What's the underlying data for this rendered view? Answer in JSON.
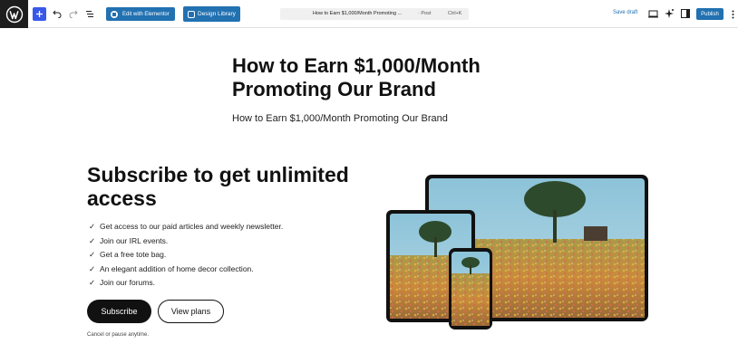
{
  "toolbar": {
    "elementor_label": "Edit with Elementor",
    "design_library_label": "Design Library",
    "command_bar": {
      "title": "How to Earn $1,000/Month Promoting ...",
      "type": "· Post",
      "shortcut": "Ctrl+K"
    },
    "save_draft_label": "Save draft",
    "publish_label": "Publish"
  },
  "post": {
    "title": "How to Earn $1,000/Month Promoting Our Brand",
    "subtitle": "How to Earn $1,000/Month Promoting Our Brand"
  },
  "subscribe": {
    "heading": "Subscribe to get unlimited access",
    "check_glyph": "✓",
    "benefits": [
      "Get access to our paid articles and weekly newsletter.",
      "Join our IRL events.",
      "Get a free tote bag.",
      "An elegant addition of home decor collection.",
      "Join our forums."
    ],
    "subscribe_label": "Subscribe",
    "plans_label": "View plans",
    "cancel_note": "Cancel or pause anytime."
  },
  "icons": {
    "logo": "wordpress-logo-icon",
    "inserter": "plus-icon",
    "undo": "undo-icon",
    "redo": "redo-icon",
    "document_overview": "list-view-icon",
    "preview": "desktop-preview-icon",
    "ai": "sparkle-icon",
    "settings": "sidebar-settings-icon",
    "more": "more-vertical-icon"
  },
  "colors": {
    "accent": "#2271b1",
    "inserter": "#3858e9",
    "dark": "#111111"
  }
}
